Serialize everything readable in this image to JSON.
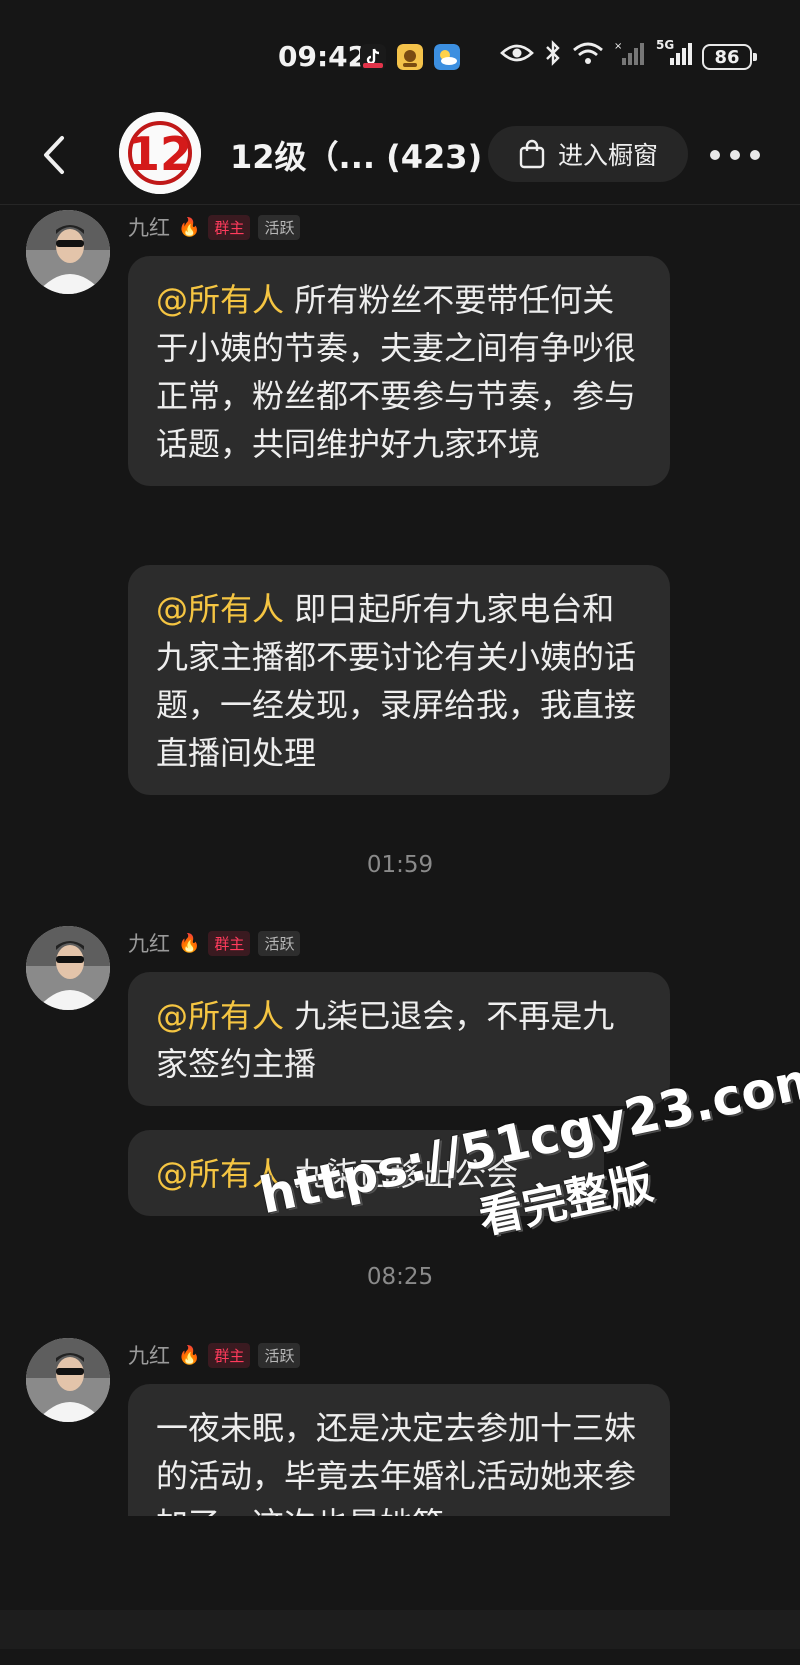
{
  "status_bar": {
    "time": "09:42",
    "network": "5G",
    "battery": "86",
    "icons": [
      "douyin-icon",
      "app-icon",
      "weather-icon",
      "eye-icon",
      "bluetooth-icon",
      "wifi-icon",
      "signal-icon",
      "signal-5g-icon"
    ]
  },
  "header": {
    "title": "12级（... (423)",
    "avatar_text": "12",
    "shop_button": "进入橱窗"
  },
  "messages": [
    {
      "sender": "九红",
      "badge_owner": "群主",
      "badge_active": "活跃",
      "bubbles": [
        {
          "mention": "@所有人",
          "text": "所有粉丝不要带任何关于小姨的节奏，夫妻之间有争吵很正常，粉丝都不要参与节奏，参与话题，共同维护好九家环境"
        },
        {
          "mention": "@所有人",
          "text": "即日起所有九家电台和九家主播都不要讨论有关小姨的话题，一经发现，录屏给我，我直接直播间处理"
        }
      ]
    },
    {
      "time": "01:59",
      "sender": "九红",
      "badge_owner": "群主",
      "badge_active": "活跃",
      "bubbles": [
        {
          "mention": "@所有人",
          "text": "九柒已退会，不再是九家签约主播"
        },
        {
          "mention": "@所有人",
          "text": "九柒已移出公会"
        }
      ]
    },
    {
      "time": "08:25",
      "sender": "九红",
      "badge_owner": "群主",
      "badge_active": "活跃",
      "bubbles": [
        {
          "mention": "",
          "text": "一夜未眠，还是决定去参加十三妹的活动，毕竟去年婚礼活动她来参加了，这次也是她答"
        }
      ]
    }
  ],
  "watermark": {
    "line1": "https://51cgy23.com",
    "line2": "看完整版"
  }
}
